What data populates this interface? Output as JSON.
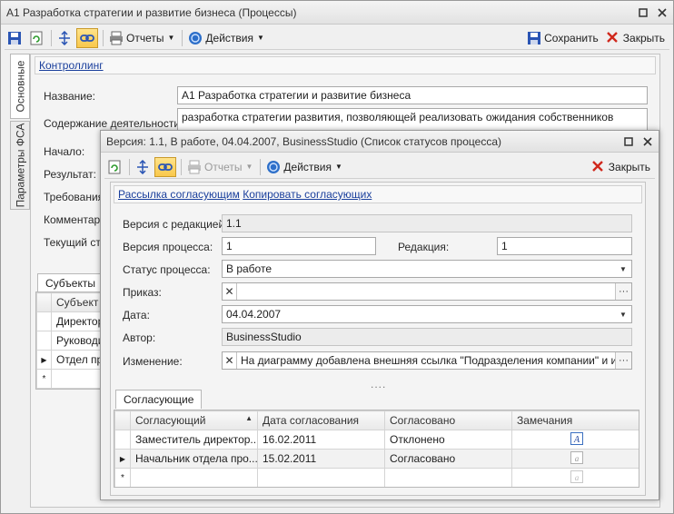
{
  "main_window": {
    "title": "А1 Разработка стратегии и развитие бизнеса (Процессы)",
    "toolbar": {
      "reports_label": "Отчеты",
      "actions_label": "Действия",
      "save_label": "Сохранить",
      "close_label": "Закрыть"
    },
    "side_tabs": [
      "Основные",
      "Параметры ФСА"
    ],
    "section_link": "Контроллинг",
    "fields": {
      "name_label": "Название:",
      "name_value": "А1 Разработка стратегии и развитие бизнеса",
      "content_label": "Содержание деятельности:",
      "content_value": "разработка стратегии развития, позволяющей реализовать ожидания собственников",
      "start_label": "Начало:",
      "result_label": "Результат:",
      "requirements_label": "Требования",
      "comment_label": "Комментари",
      "current_label": "Текущий ста"
    },
    "subjects_tab": "Субъекты",
    "subjects_grid": {
      "header": "Субъект",
      "rows": [
        "Директор",
        "Руководит",
        "Отдел про"
      ]
    }
  },
  "dialog": {
    "title": "Версия: 1.1, В работе, 04.04.2007, BusinessStudio (Список статусов процесса)",
    "toolbar": {
      "reports_label": "Отчеты",
      "actions_label": "Действия",
      "close_label": "Закрыть"
    },
    "links": {
      "mailing": "Рассылка согласующим",
      "copy": "Копировать согласующих"
    },
    "fields": {
      "version_edit_label": "Версия с редакцией:",
      "version_edit_value": "1.1",
      "process_version_label": "Версия процесса:",
      "process_version_value": "1",
      "edition_label": "Редакция:",
      "edition_value": "1",
      "status_label": "Статус процесса:",
      "status_value": "В работе",
      "order_label": "Приказ:",
      "order_value": "",
      "date_label": "Дата:",
      "date_value": "04.04.2007",
      "author_label": "Автор:",
      "author_value": "BusinessStudio",
      "change_label": "Изменение:",
      "change_value": "На диаграмму добавлена внешняя ссылка \"Подразделения компании\" и исходящ"
    },
    "splitter": "....",
    "approvers_tab": "Согласующие",
    "approvers_grid": {
      "columns": [
        "Согласующий",
        "Дата согласования",
        "Согласовано",
        "Замечания"
      ],
      "rows": [
        {
          "approver": "Заместитель директор...",
          "date": "16.02.2011",
          "status": "Отклонено"
        },
        {
          "approver": "Начальник отдела про...",
          "date": "15.02.2011",
          "status": "Согласовано"
        }
      ]
    }
  },
  "colors": {
    "link": "#1a3f9c",
    "active_button": "#f9c84b"
  }
}
